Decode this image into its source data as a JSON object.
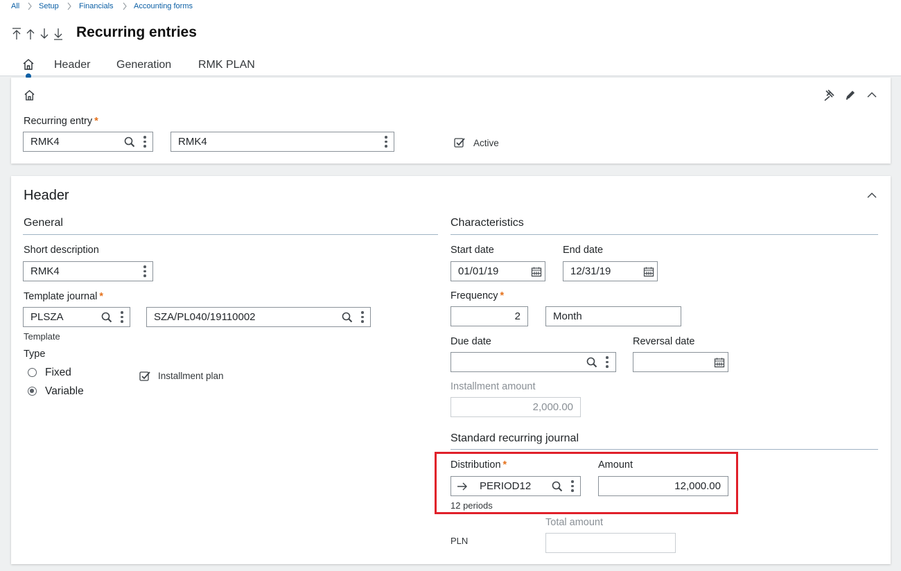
{
  "breadcrumb": {
    "all": "All",
    "setup": "Setup",
    "financials": "Financials",
    "accounting_forms": "Accounting forms"
  },
  "page": {
    "title": "Recurring entries"
  },
  "tabs": {
    "header": "Header",
    "generation": "Generation",
    "rmk_plan": "RMK PLAN"
  },
  "top_section": {
    "recurring_entry_label": "Recurring entry",
    "recurring_entry_value": "RMK4",
    "description_value": "RMK4",
    "active_label": "Active",
    "active_checked": true
  },
  "header_section": {
    "title": "Header",
    "general": {
      "title": "General",
      "short_description_label": "Short description",
      "short_description_value": "RMK4",
      "template_journal_label": "Template journal",
      "template_journal_code": "PLSZA",
      "template_journal_ref": "SZA/PL040/19110002",
      "template_caption": "Template",
      "type_label": "Type",
      "type_options": [
        "Fixed",
        "Variable"
      ],
      "type_selected": "Variable",
      "installment_plan_label": "Installment plan",
      "installment_plan_checked": true
    },
    "characteristics": {
      "title": "Characteristics",
      "start_date_label": "Start date",
      "start_date_value": "01/01/19",
      "end_date_label": "End date",
      "end_date_value": "12/31/19",
      "frequency_label": "Frequency",
      "frequency_value": "2",
      "frequency_unit": "Month",
      "due_date_label": "Due date",
      "due_date_value": "",
      "reversal_date_label": "Reversal date",
      "reversal_date_value": "",
      "installment_amount_label": "Installment amount",
      "installment_amount_value": "2,000.00"
    },
    "standard_recurring_journal": {
      "title": "Standard recurring journal",
      "distribution_label": "Distribution",
      "distribution_value": "PERIOD12",
      "distribution_caption": "12 periods",
      "amount_label": "Amount",
      "amount_value": "12,000.00",
      "total_amount_label": "Total amount",
      "currency": "PLN",
      "total_amount_value": ""
    }
  },
  "colors": {
    "accent": "#0b5fa5",
    "required": "#e5721d",
    "highlight": "#e0202a"
  }
}
